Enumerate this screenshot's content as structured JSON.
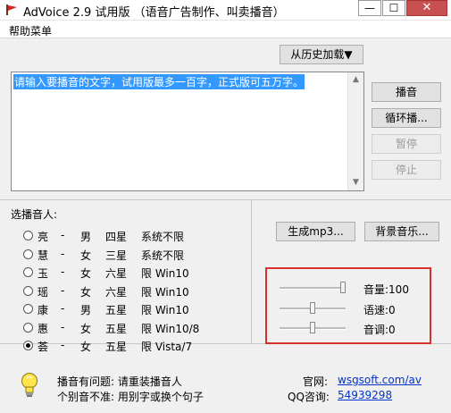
{
  "window": {
    "title": "AdVoice 2.9 试用版 （语音广告制作、叫卖播音）",
    "min_glyph": "—",
    "max_glyph": "☐",
    "close_glyph": "✕",
    "app_icon": "red-flag-icon"
  },
  "menu": {
    "help": "帮助菜单"
  },
  "history_button": "从历史加载▼",
  "text_input": {
    "value": "请输入要播音的文字，试用版最多一百字，正式版可五万字。"
  },
  "side_buttons": {
    "play": "播音",
    "loop": "循环播...",
    "pause": "暂停",
    "stop": "停止"
  },
  "voices": {
    "label": "选播音人:",
    "selected_index": 6,
    "items": [
      {
        "name": "亮",
        "dash": "-",
        "gender": "男",
        "stars": "四星",
        "limit": "系统不限"
      },
      {
        "name": "慧",
        "dash": "-",
        "gender": "女",
        "stars": "三星",
        "limit": "系统不限"
      },
      {
        "name": "玉",
        "dash": "-",
        "gender": "女",
        "stars": "六星",
        "limit": "限 Win10"
      },
      {
        "name": "瑶",
        "dash": "-",
        "gender": "女",
        "stars": "六星",
        "limit": "限 Win10"
      },
      {
        "name": "康",
        "dash": "-",
        "gender": "男",
        "stars": "五星",
        "limit": "限 Win10"
      },
      {
        "name": "惠",
        "dash": "-",
        "gender": "女",
        "stars": "五星",
        "limit": "限 Win10/8"
      },
      {
        "name": "荟",
        "dash": "-",
        "gender": "女",
        "stars": "五星",
        "limit": "限 Vista/7"
      }
    ]
  },
  "actions": {
    "mp3": "生成mp3...",
    "bgm": "背景音乐..."
  },
  "sliders": {
    "volume": {
      "label": "音量:100",
      "fraction": 1.0
    },
    "speed": {
      "label": "语速:0",
      "fraction": 0.5
    },
    "pitch": {
      "label": "音调:0",
      "fraction": 0.5
    }
  },
  "footer": {
    "tip_icon": "lightbulb-icon",
    "tip_line1": "播音有问题: 请重装播音人",
    "tip_line2": "个别音不准: 用别字或换个句子",
    "site_label": "官网:",
    "site_link": "wsgsoft.com/av",
    "qq_label": "QQ咨询:",
    "qq_number": "54939298"
  },
  "colors": {
    "highlight_box": "#d9302c",
    "selection": "#3399ff",
    "link": "#0033cc"
  }
}
